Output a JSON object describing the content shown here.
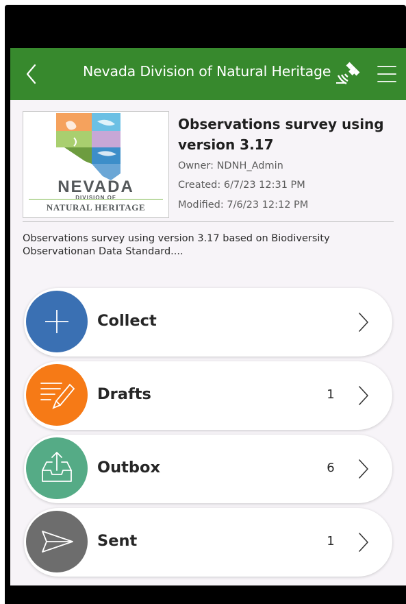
{
  "header": {
    "title": "Nevada Division of Natural Heritage",
    "back_icon": "chevron-left-icon",
    "gps_icon": "satellite-gps-icon",
    "menu_icon": "hamburger-menu-icon",
    "color": "#37892d"
  },
  "survey": {
    "logo_text_line1": "NEVADA",
    "logo_text_line2": "DIVISION OF",
    "logo_text_line3": "NATURAL HERITAGE",
    "title": "Observations survey using version 3.17",
    "owner": "Owner: NDNH_Admin",
    "created": "Created: 6/7/23 12:31 PM",
    "modified": "Modified: 7/6/23 12:12 PM",
    "description": "Observations survey using version 3.17 based on Biodiversity Observationan Data Standard...."
  },
  "actions": [
    {
      "label": "Collect",
      "count": "",
      "color": "#3a70b3",
      "icon": "plus-icon"
    },
    {
      "label": "Drafts",
      "count": "1",
      "color": "#f67a16",
      "icon": "edit-list-icon"
    },
    {
      "label": "Outbox",
      "count": "6",
      "color": "#55ab86",
      "icon": "upload-tray-icon"
    },
    {
      "label": "Sent",
      "count": "1",
      "color": "#6d6d6d",
      "icon": "send-icon"
    }
  ]
}
